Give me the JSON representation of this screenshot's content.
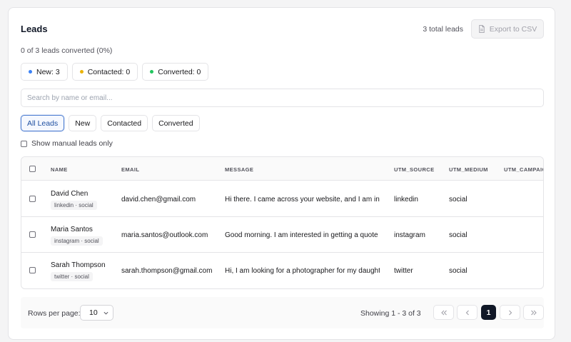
{
  "header": {
    "title": "Leads",
    "total": "3 total leads",
    "export_label": "Export to CSV"
  },
  "summary": {
    "converted_text": "0 of 3 leads converted (0%)",
    "pills": [
      {
        "label": "New: 3",
        "color": "#3b82f6"
      },
      {
        "label": "Contacted: 0",
        "color": "#eab308"
      },
      {
        "label": "Converted: 0",
        "color": "#22c55e"
      }
    ]
  },
  "search": {
    "placeholder": "Search by name or email...",
    "value": ""
  },
  "filters": {
    "tabs": [
      "All Leads",
      "New",
      "Contacted",
      "Converted"
    ],
    "active": "All Leads",
    "manual_only_label": "Show manual leads only"
  },
  "table": {
    "columns": [
      "NAME",
      "EMAIL",
      "MESSAGE",
      "UTM_SOURCE",
      "UTM_MEDIUM",
      "UTM_CAMPAIGN"
    ],
    "rows": [
      {
        "name": "David Chen",
        "tag": "linkedin · social",
        "email": "david.chen@gmail.com",
        "message": "Hi there. I came across your website, and I am interested",
        "utm_source": "linkedin",
        "utm_medium": "social"
      },
      {
        "name": "Maria Santos",
        "tag": "instagram · social",
        "email": "maria.santos@outlook.com",
        "message": "Good morning. I am interested in getting a quote for",
        "utm_source": "instagram",
        "utm_medium": "social"
      },
      {
        "name": "Sarah Thompson",
        "tag": "twitter · social",
        "email": "sarah.thompson@gmail.com",
        "message": "Hi, I am looking for a photographer for my daughter's",
        "utm_source": "twitter",
        "utm_medium": "social"
      }
    ]
  },
  "pagination": {
    "rows_per_page_label": "Rows per page:",
    "rows_per_page_value": "10",
    "showing": "Showing 1 - 3 of 3",
    "current_page": "1"
  }
}
